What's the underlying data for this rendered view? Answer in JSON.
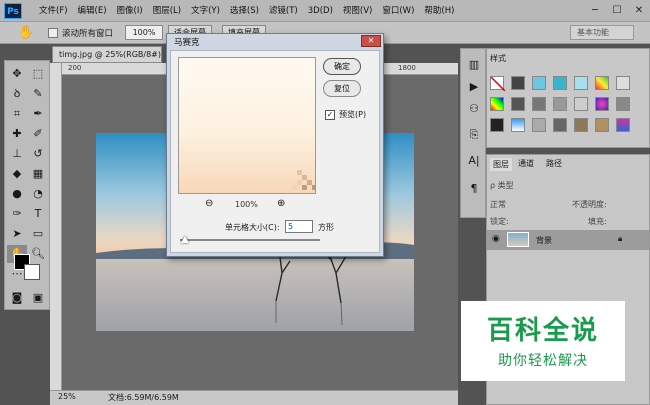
{
  "app": {
    "logo": "Ps"
  },
  "menu": [
    "文件(F)",
    "编辑(E)",
    "图像(I)",
    "图层(L)",
    "文字(Y)",
    "选择(S)",
    "滤镜(T)",
    "3D(D)",
    "视图(V)",
    "窗口(W)",
    "帮助(H)"
  ],
  "options": {
    "scroll_all_label": "滚动所有窗口",
    "zoom_value": "100%",
    "fit_screen_label": "适合屏幕",
    "fill_screen_label": "填充屏幕",
    "workspace": "基本功能"
  },
  "document": {
    "tab_title": "timg.jpg @ 25%(RGB/8#)",
    "ruler_marks": [
      "200",
      "1800"
    ],
    "zoom_status": "25%",
    "doc_size": "文档:6.59M/6.59M"
  },
  "styles_panel": {
    "tab": "样式"
  },
  "layers_panel": {
    "tabs": [
      "图层",
      "通道",
      "路径"
    ],
    "kind_filter": "类型",
    "blend_mode": "正常",
    "opacity_label": "不透明度:",
    "lock_label": "锁定:",
    "fill_label": "填充:",
    "layer_name": "背景"
  },
  "dialog": {
    "title": "马赛克",
    "ok_label": "确定",
    "reset_label": "复位",
    "preview_label": "预览(P)",
    "zoom_percent": "100%",
    "cell_size_label": "单元格大小(C):",
    "cell_size_value": "5",
    "unit": "方形"
  },
  "watermark": {
    "title": "百科全说",
    "subtitle": "助你轻松解决"
  }
}
